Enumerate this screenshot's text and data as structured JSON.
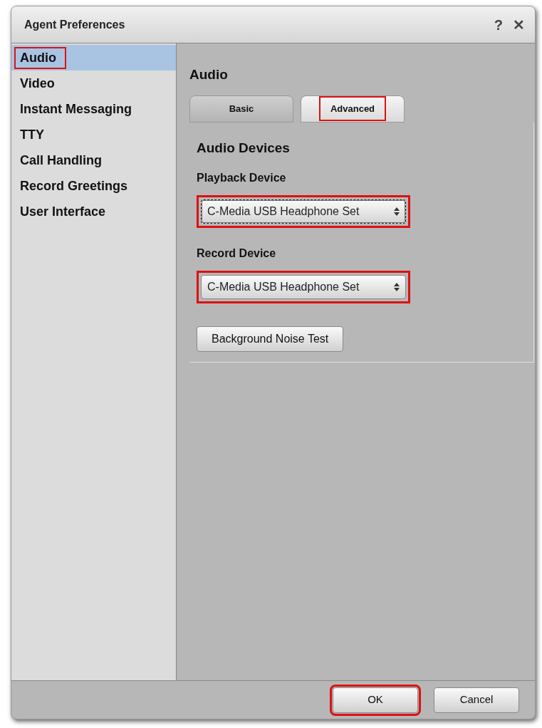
{
  "window": {
    "title": "Agent Preferences",
    "help": "?",
    "close": "✕"
  },
  "sidebar": {
    "items": [
      {
        "label": "Audio",
        "selected": true,
        "highlighted": true
      },
      {
        "label": "Video",
        "selected": false,
        "highlighted": false
      },
      {
        "label": "Instant Messaging",
        "selected": false,
        "highlighted": false
      },
      {
        "label": "TTY",
        "selected": false,
        "highlighted": false
      },
      {
        "label": "Call Handling",
        "selected": false,
        "highlighted": false
      },
      {
        "label": "Record Greetings",
        "selected": false,
        "highlighted": false
      },
      {
        "label": "User Interface",
        "selected": false,
        "highlighted": false
      }
    ]
  },
  "content": {
    "title": "Audio",
    "tabs": [
      {
        "label": "Basic",
        "selected": false,
        "highlighted": false
      },
      {
        "label": "Advanced",
        "selected": true,
        "highlighted": true
      }
    ],
    "section_title": "Audio Devices",
    "fields": [
      {
        "label": "Playback Device",
        "value": "C-Media USB Headphone Set",
        "highlighted": true,
        "focused": true
      },
      {
        "label": "Record Device",
        "value": "C-Media USB Headphone Set",
        "highlighted": true,
        "focused": false
      }
    ],
    "test_button": "Background Noise Test"
  },
  "buttons": [
    {
      "label": "OK",
      "highlighted": true
    },
    {
      "label": "Cancel",
      "highlighted": false
    }
  ]
}
